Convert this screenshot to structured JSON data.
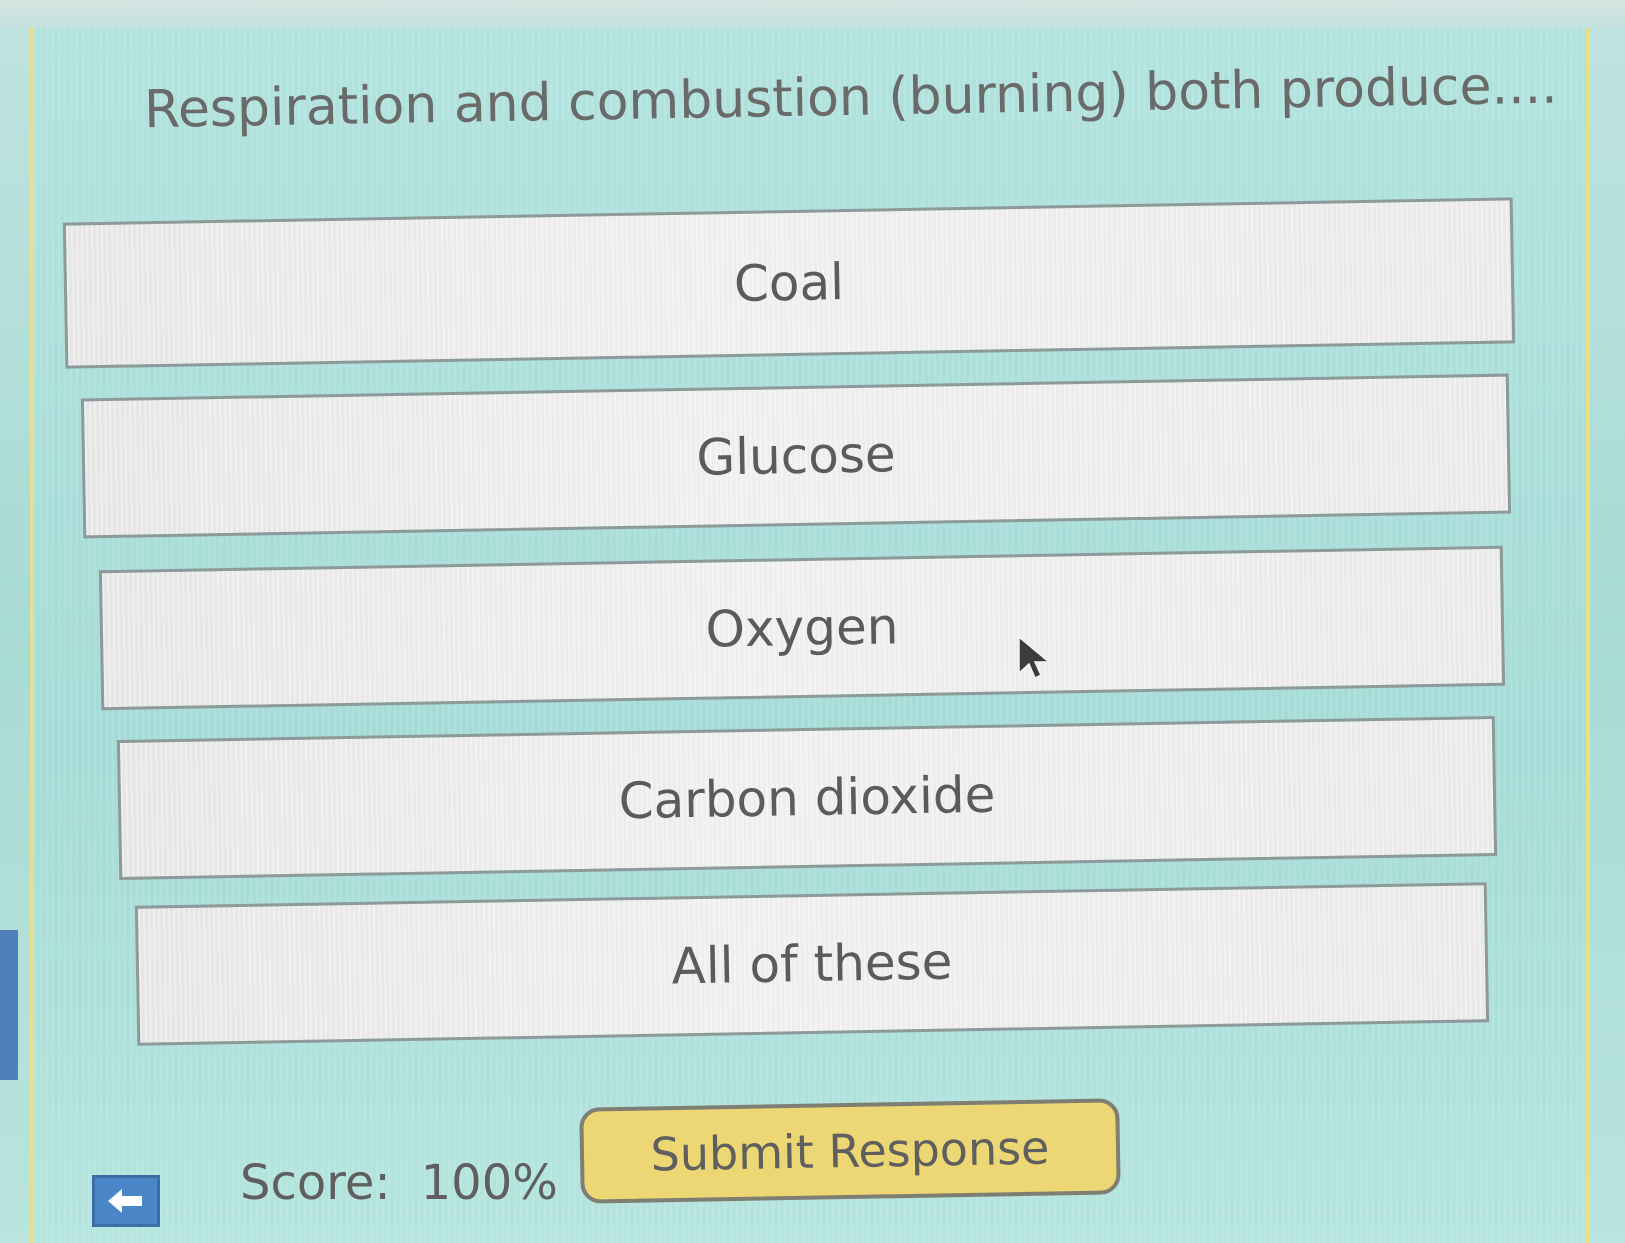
{
  "question": "Respiration and combustion (burning) both produce....",
  "answers": [
    {
      "label": "Coal"
    },
    {
      "label": "Glucose"
    },
    {
      "label": "Oxygen"
    },
    {
      "label": "Carbon dioxide"
    },
    {
      "label": "All of these"
    }
  ],
  "footer": {
    "score_label": "Score:",
    "score_value": "100%",
    "submit_label": "Submit Response",
    "back_icon": "back-arrow-icon"
  },
  "colors": {
    "background": "#a9dbd6",
    "answer_fill": "#e9e9e9",
    "submit_fill": "#ecd774",
    "back_button": "#4b86c8",
    "frame_border": "#e9e084"
  }
}
